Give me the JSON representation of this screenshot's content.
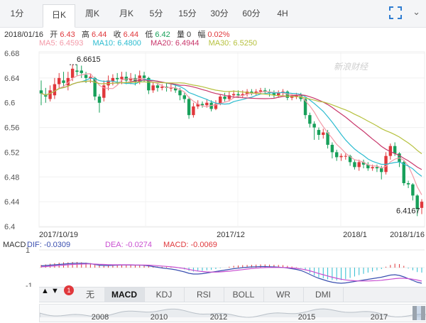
{
  "tabs": [
    {
      "label": "1分",
      "x": 8,
      "w": 32
    },
    {
      "label": "日K",
      "x": 60,
      "w": 44,
      "active": true
    },
    {
      "label": "周K",
      "x": 110,
      "w": 40
    },
    {
      "label": "月K",
      "x": 158,
      "w": 40
    },
    {
      "label": "5分",
      "x": 204,
      "w": 32
    },
    {
      "label": "15分",
      "x": 246,
      "w": 36
    },
    {
      "label": "30分",
      "x": 291,
      "w": 36
    },
    {
      "label": "60分",
      "x": 336,
      "w": 36
    },
    {
      "label": "4H",
      "x": 384,
      "w": 28
    }
  ],
  "info": {
    "date": "2018/01/16",
    "open_label": "开",
    "open": "6.43",
    "high_label": "高",
    "high": "6.44",
    "close_label": "收",
    "close": "6.44",
    "low_label": "低",
    "low": "6.42",
    "volume_label": "量",
    "volume": "0",
    "change_label": "幅",
    "change": "0.02%"
  },
  "ma_labels": [
    {
      "text": "MA5: 6.4593",
      "color": "#f39aa8"
    },
    {
      "text": "MA10: 6.4800",
      "color": "#2cbcd0"
    },
    {
      "text": "MA20: 6.4944",
      "color": "#c8376b"
    },
    {
      "text": "MA30: 6.5250",
      "color": "#b6c13e"
    }
  ],
  "watermark": "新浪财经",
  "macd_labels": {
    "name": "MACD",
    "dif": "DIF: -0.0309",
    "dea": "DEA: -0.0274",
    "macd": "MACD: -0.0069"
  },
  "bottom_tabs": [
    "无",
    "MACD",
    "KDJ",
    "RSI",
    "BOLL",
    "WR",
    "DMI"
  ],
  "bottom_active": "MACD",
  "badge": "1",
  "nav_years": [
    "2008",
    "2010",
    "2012",
    "2015",
    "2017"
  ],
  "colors": {
    "up": "#e0383c",
    "down": "#17a05a",
    "dif": "#3a4fb0",
    "dea": "#c94fd1"
  },
  "chart_data": {
    "type": "candlestick",
    "y_ticks": [
      6.68,
      6.64,
      6.6,
      6.56,
      6.52,
      6.48,
      6.44,
      6.4
    ],
    "ylim": [
      6.4,
      6.68
    ],
    "x_labels": [
      "2017/10/19",
      "2017/12",
      "2018/1",
      "2018/1/16"
    ],
    "annotations": [
      {
        "text": "6.6615",
        "value": 6.6615
      },
      {
        "text": "6.4167",
        "value": 6.4167
      }
    ],
    "candles": [
      [
        6.62,
        6.615,
        6.636,
        6.596
      ],
      [
        6.612,
        6.61,
        6.624,
        6.6
      ],
      [
        6.606,
        6.62,
        6.628,
        6.602
      ],
      [
        6.612,
        6.63,
        6.64,
        6.606
      ],
      [
        6.63,
        6.64,
        6.648,
        6.622
      ],
      [
        6.636,
        6.632,
        6.65,
        6.624
      ],
      [
        6.628,
        6.64,
        6.65,
        6.62
      ],
      [
        6.64,
        6.655,
        6.662,
        6.635
      ],
      [
        6.652,
        6.65,
        6.662,
        6.644
      ],
      [
        6.652,
        6.648,
        6.66,
        6.64
      ],
      [
        6.645,
        6.64,
        6.65,
        6.632
      ],
      [
        6.64,
        6.642,
        6.646,
        6.632
      ],
      [
        6.64,
        6.61,
        6.642,
        6.604
      ],
      [
        6.61,
        6.6,
        6.614,
        6.584
      ],
      [
        6.608,
        6.628,
        6.636,
        6.602
      ],
      [
        6.628,
        6.636,
        6.644,
        6.62
      ],
      [
        6.634,
        6.64,
        6.646,
        6.628
      ],
      [
        6.64,
        6.638,
        6.648,
        6.63
      ],
      [
        6.638,
        6.642,
        6.65,
        6.63
      ],
      [
        6.642,
        6.636,
        6.65,
        6.63
      ],
      [
        6.636,
        6.64,
        6.648,
        6.63
      ],
      [
        6.64,
        6.634,
        6.646,
        6.628
      ],
      [
        6.634,
        6.644,
        6.652,
        6.63
      ],
      [
        6.644,
        6.64,
        6.65,
        6.634
      ],
      [
        6.64,
        6.62,
        6.642,
        6.614
      ],
      [
        6.62,
        6.628,
        6.634,
        6.616
      ],
      [
        6.628,
        6.624,
        6.632,
        6.618
      ],
      [
        6.624,
        6.626,
        6.63,
        6.62
      ],
      [
        6.626,
        6.624,
        6.632,
        6.618
      ],
      [
        6.624,
        6.624,
        6.63,
        6.618
      ],
      [
        6.624,
        6.62,
        6.63,
        6.616
      ],
      [
        6.62,
        6.612,
        6.624,
        6.604
      ],
      [
        6.612,
        6.606,
        6.616,
        6.6
      ],
      [
        6.606,
        6.58,
        6.61,
        6.574
      ],
      [
        6.58,
        6.594,
        6.6,
        6.576
      ],
      [
        6.594,
        6.598,
        6.604,
        6.59
      ],
      [
        6.598,
        6.596,
        6.602,
        6.592
      ],
      [
        6.596,
        6.6,
        6.606,
        6.592
      ],
      [
        6.6,
        6.59,
        6.604,
        6.586
      ],
      [
        6.59,
        6.598,
        6.604,
        6.588
      ],
      [
        6.598,
        6.61,
        6.614,
        6.596
      ],
      [
        6.61,
        6.606,
        6.616,
        6.602
      ],
      [
        6.606,
        6.612,
        6.618,
        6.602
      ],
      [
        6.612,
        6.614,
        6.62,
        6.608
      ],
      [
        6.614,
        6.612,
        6.62,
        6.608
      ],
      [
        6.612,
        6.614,
        6.62,
        6.608
      ],
      [
        6.614,
        6.618,
        6.622,
        6.61
      ],
      [
        6.618,
        6.616,
        6.622,
        6.612
      ],
      [
        6.616,
        6.618,
        6.622,
        6.612
      ],
      [
        6.618,
        6.62,
        6.624,
        6.614
      ],
      [
        6.62,
        6.618,
        6.624,
        6.614
      ],
      [
        6.618,
        6.616,
        6.622,
        6.61
      ],
      [
        6.616,
        6.612,
        6.62,
        6.608
      ],
      [
        6.612,
        6.616,
        6.62,
        6.608
      ],
      [
        6.616,
        6.618,
        6.622,
        6.612
      ],
      [
        6.618,
        6.608,
        6.62,
        6.604
      ],
      [
        6.608,
        6.61,
        6.614,
        6.604
      ],
      [
        6.61,
        6.612,
        6.616,
        6.606
      ],
      [
        6.612,
        6.606,
        6.616,
        6.602
      ],
      [
        6.606,
        6.58,
        6.608,
        6.574
      ],
      [
        6.58,
        6.566,
        6.584,
        6.56
      ],
      [
        6.566,
        6.56,
        6.57,
        6.54
      ],
      [
        6.556,
        6.548,
        6.56,
        6.54
      ],
      [
        6.548,
        6.552,
        6.558,
        6.542
      ],
      [
        6.552,
        6.532,
        6.556,
        6.526
      ],
      [
        6.532,
        6.52,
        6.536,
        6.51
      ],
      [
        6.52,
        6.512,
        6.524,
        6.506
      ],
      [
        6.512,
        6.514,
        6.518,
        6.506
      ],
      [
        6.514,
        6.514,
        6.518,
        6.508
      ],
      [
        6.514,
        6.504,
        6.516,
        6.498
      ],
      [
        6.504,
        6.496,
        6.508,
        6.492
      ],
      [
        6.496,
        6.504,
        6.508,
        6.49
      ],
      [
        6.504,
        6.5,
        6.508,
        6.494
      ],
      [
        6.5,
        6.494,
        6.504,
        6.49
      ],
      [
        6.494,
        6.496,
        6.5,
        6.49
      ],
      [
        6.496,
        6.494,
        6.5,
        6.488
      ],
      [
        6.494,
        6.488,
        6.498,
        6.476
      ],
      [
        6.488,
        6.514,
        6.52,
        6.484
      ],
      [
        6.514,
        6.53,
        6.534,
        6.508
      ],
      [
        6.53,
        6.518,
        6.536,
        6.514
      ],
      [
        6.518,
        6.504,
        6.52,
        6.496
      ],
      [
        6.504,
        6.47,
        6.506,
        6.466
      ],
      [
        6.47,
        6.468,
        6.474,
        6.462
      ],
      [
        6.468,
        6.45,
        6.47,
        6.442
      ],
      [
        6.45,
        6.428,
        6.452,
        6.4167
      ],
      [
        6.43,
        6.44,
        6.444,
        6.42
      ]
    ],
    "macd": {
      "ylim": [
        -1,
        1
      ],
      "y_ticks": [
        1,
        -1
      ],
      "hist": [
        0.15,
        0.18,
        0.22,
        0.25,
        0.28,
        0.3,
        0.3,
        0.32,
        0.32,
        0.3,
        0.28,
        0.25,
        0.2,
        0.15,
        0.12,
        0.12,
        0.14,
        0.15,
        0.16,
        0.15,
        0.15,
        0.14,
        0.15,
        0.14,
        0.1,
        0.08,
        0.06,
        0.05,
        0.04,
        0.03,
        0.0,
        -0.05,
        -0.1,
        -0.18,
        -0.22,
        -0.2,
        -0.18,
        -0.15,
        -0.12,
        -0.08,
        -0.03,
        0.0,
        0.05,
        0.1,
        0.12,
        0.14,
        0.15,
        0.16,
        0.17,
        0.18,
        0.18,
        0.17,
        0.16,
        0.15,
        0.14,
        0.1,
        0.06,
        0.02,
        -0.02,
        -0.15,
        -0.3,
        -0.45,
        -0.55,
        -0.6,
        -0.66,
        -0.7,
        -0.72,
        -0.7,
        -0.65,
        -0.58,
        -0.5,
        -0.42,
        -0.35,
        -0.28,
        -0.22,
        -0.15,
        -0.08,
        0.05,
        0.15,
        0.22,
        0.2,
        0.1,
        -0.05,
        -0.15,
        -0.25,
        -0.28
      ],
      "dif": [
        0.1,
        0.12,
        0.14,
        0.16,
        0.18,
        0.2,
        0.22,
        0.24,
        0.25,
        0.25,
        0.24,
        0.22,
        0.18,
        0.14,
        0.12,
        0.12,
        0.13,
        0.14,
        0.15,
        0.15,
        0.15,
        0.14,
        0.14,
        0.13,
        0.1,
        0.06,
        0.02,
        -0.02,
        -0.05,
        -0.08,
        -0.12,
        -0.18,
        -0.24,
        -0.32,
        -0.36,
        -0.36,
        -0.34,
        -0.3,
        -0.26,
        -0.22,
        -0.18,
        -0.14,
        -0.1,
        -0.06,
        -0.03,
        0.0,
        0.02,
        0.04,
        0.05,
        0.06,
        0.06,
        0.05,
        0.04,
        0.03,
        0.01,
        -0.02,
        -0.06,
        -0.1,
        -0.16,
        -0.26,
        -0.38,
        -0.5,
        -0.6,
        -0.68,
        -0.76,
        -0.82,
        -0.86,
        -0.88,
        -0.86,
        -0.82,
        -0.78,
        -0.74,
        -0.7,
        -0.66,
        -0.62,
        -0.58,
        -0.54,
        -0.48,
        -0.42,
        -0.4,
        -0.44,
        -0.52,
        -0.62,
        -0.72,
        -0.82,
        -0.88
      ],
      "dea": [
        0.05,
        0.06,
        0.08,
        0.1,
        0.12,
        0.14,
        0.16,
        0.18,
        0.19,
        0.2,
        0.21,
        0.21,
        0.2,
        0.19,
        0.18,
        0.17,
        0.16,
        0.16,
        0.16,
        0.16,
        0.16,
        0.15,
        0.15,
        0.15,
        0.14,
        0.13,
        0.11,
        0.09,
        0.07,
        0.05,
        0.02,
        -0.01,
        -0.05,
        -0.1,
        -0.15,
        -0.19,
        -0.22,
        -0.24,
        -0.25,
        -0.25,
        -0.24,
        -0.22,
        -0.2,
        -0.17,
        -0.14,
        -0.11,
        -0.08,
        -0.05,
        -0.03,
        -0.01,
        0.0,
        0.01,
        0.01,
        0.01,
        0.01,
        0.0,
        -0.02,
        -0.04,
        -0.07,
        -0.12,
        -0.18,
        -0.25,
        -0.33,
        -0.4,
        -0.47,
        -0.54,
        -0.6,
        -0.65,
        -0.69,
        -0.72,
        -0.74,
        -0.75,
        -0.75,
        -0.75,
        -0.74,
        -0.73,
        -0.71,
        -0.68,
        -0.65,
        -0.62,
        -0.6,
        -0.6,
        -0.62,
        -0.65,
        -0.7,
        -0.76
      ]
    }
  }
}
